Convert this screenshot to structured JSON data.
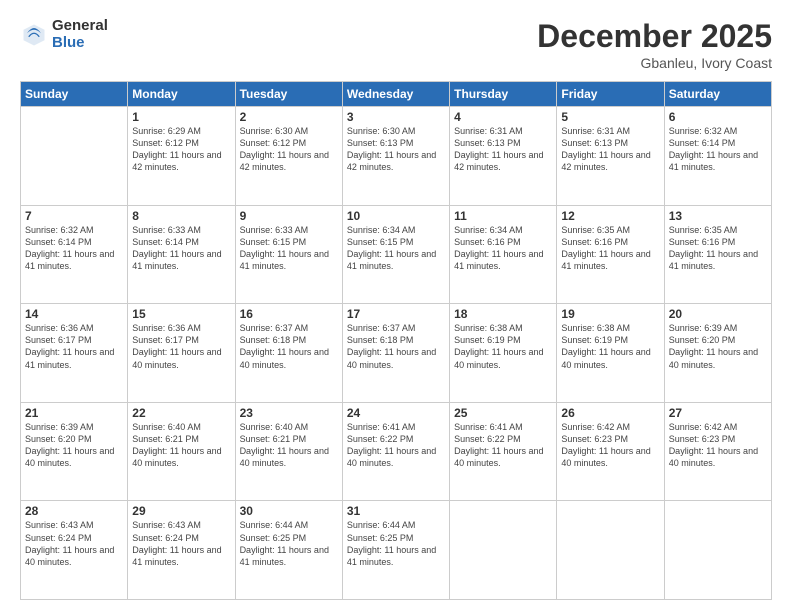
{
  "logo": {
    "general": "General",
    "blue": "Blue"
  },
  "title": "December 2025",
  "subtitle": "Gbanleu, Ivory Coast",
  "weekdays": [
    "Sunday",
    "Monday",
    "Tuesday",
    "Wednesday",
    "Thursday",
    "Friday",
    "Saturday"
  ],
  "weeks": [
    [
      {
        "day": "",
        "sunrise": "",
        "sunset": "",
        "daylight": ""
      },
      {
        "day": "1",
        "sunrise": "Sunrise: 6:29 AM",
        "sunset": "Sunset: 6:12 PM",
        "daylight": "Daylight: 11 hours and 42 minutes."
      },
      {
        "day": "2",
        "sunrise": "Sunrise: 6:30 AM",
        "sunset": "Sunset: 6:12 PM",
        "daylight": "Daylight: 11 hours and 42 minutes."
      },
      {
        "day": "3",
        "sunrise": "Sunrise: 6:30 AM",
        "sunset": "Sunset: 6:13 PM",
        "daylight": "Daylight: 11 hours and 42 minutes."
      },
      {
        "day": "4",
        "sunrise": "Sunrise: 6:31 AM",
        "sunset": "Sunset: 6:13 PM",
        "daylight": "Daylight: 11 hours and 42 minutes."
      },
      {
        "day": "5",
        "sunrise": "Sunrise: 6:31 AM",
        "sunset": "Sunset: 6:13 PM",
        "daylight": "Daylight: 11 hours and 42 minutes."
      },
      {
        "day": "6",
        "sunrise": "Sunrise: 6:32 AM",
        "sunset": "Sunset: 6:14 PM",
        "daylight": "Daylight: 11 hours and 41 minutes."
      }
    ],
    [
      {
        "day": "7",
        "sunrise": "Sunrise: 6:32 AM",
        "sunset": "Sunset: 6:14 PM",
        "daylight": "Daylight: 11 hours and 41 minutes."
      },
      {
        "day": "8",
        "sunrise": "Sunrise: 6:33 AM",
        "sunset": "Sunset: 6:14 PM",
        "daylight": "Daylight: 11 hours and 41 minutes."
      },
      {
        "day": "9",
        "sunrise": "Sunrise: 6:33 AM",
        "sunset": "Sunset: 6:15 PM",
        "daylight": "Daylight: 11 hours and 41 minutes."
      },
      {
        "day": "10",
        "sunrise": "Sunrise: 6:34 AM",
        "sunset": "Sunset: 6:15 PM",
        "daylight": "Daylight: 11 hours and 41 minutes."
      },
      {
        "day": "11",
        "sunrise": "Sunrise: 6:34 AM",
        "sunset": "Sunset: 6:16 PM",
        "daylight": "Daylight: 11 hours and 41 minutes."
      },
      {
        "day": "12",
        "sunrise": "Sunrise: 6:35 AM",
        "sunset": "Sunset: 6:16 PM",
        "daylight": "Daylight: 11 hours and 41 minutes."
      },
      {
        "day": "13",
        "sunrise": "Sunrise: 6:35 AM",
        "sunset": "Sunset: 6:16 PM",
        "daylight": "Daylight: 11 hours and 41 minutes."
      }
    ],
    [
      {
        "day": "14",
        "sunrise": "Sunrise: 6:36 AM",
        "sunset": "Sunset: 6:17 PM",
        "daylight": "Daylight: 11 hours and 41 minutes."
      },
      {
        "day": "15",
        "sunrise": "Sunrise: 6:36 AM",
        "sunset": "Sunset: 6:17 PM",
        "daylight": "Daylight: 11 hours and 40 minutes."
      },
      {
        "day": "16",
        "sunrise": "Sunrise: 6:37 AM",
        "sunset": "Sunset: 6:18 PM",
        "daylight": "Daylight: 11 hours and 40 minutes."
      },
      {
        "day": "17",
        "sunrise": "Sunrise: 6:37 AM",
        "sunset": "Sunset: 6:18 PM",
        "daylight": "Daylight: 11 hours and 40 minutes."
      },
      {
        "day": "18",
        "sunrise": "Sunrise: 6:38 AM",
        "sunset": "Sunset: 6:19 PM",
        "daylight": "Daylight: 11 hours and 40 minutes."
      },
      {
        "day": "19",
        "sunrise": "Sunrise: 6:38 AM",
        "sunset": "Sunset: 6:19 PM",
        "daylight": "Daylight: 11 hours and 40 minutes."
      },
      {
        "day": "20",
        "sunrise": "Sunrise: 6:39 AM",
        "sunset": "Sunset: 6:20 PM",
        "daylight": "Daylight: 11 hours and 40 minutes."
      }
    ],
    [
      {
        "day": "21",
        "sunrise": "Sunrise: 6:39 AM",
        "sunset": "Sunset: 6:20 PM",
        "daylight": "Daylight: 11 hours and 40 minutes."
      },
      {
        "day": "22",
        "sunrise": "Sunrise: 6:40 AM",
        "sunset": "Sunset: 6:21 PM",
        "daylight": "Daylight: 11 hours and 40 minutes."
      },
      {
        "day": "23",
        "sunrise": "Sunrise: 6:40 AM",
        "sunset": "Sunset: 6:21 PM",
        "daylight": "Daylight: 11 hours and 40 minutes."
      },
      {
        "day": "24",
        "sunrise": "Sunrise: 6:41 AM",
        "sunset": "Sunset: 6:22 PM",
        "daylight": "Daylight: 11 hours and 40 minutes."
      },
      {
        "day": "25",
        "sunrise": "Sunrise: 6:41 AM",
        "sunset": "Sunset: 6:22 PM",
        "daylight": "Daylight: 11 hours and 40 minutes."
      },
      {
        "day": "26",
        "sunrise": "Sunrise: 6:42 AM",
        "sunset": "Sunset: 6:23 PM",
        "daylight": "Daylight: 11 hours and 40 minutes."
      },
      {
        "day": "27",
        "sunrise": "Sunrise: 6:42 AM",
        "sunset": "Sunset: 6:23 PM",
        "daylight": "Daylight: 11 hours and 40 minutes."
      }
    ],
    [
      {
        "day": "28",
        "sunrise": "Sunrise: 6:43 AM",
        "sunset": "Sunset: 6:24 PM",
        "daylight": "Daylight: 11 hours and 40 minutes."
      },
      {
        "day": "29",
        "sunrise": "Sunrise: 6:43 AM",
        "sunset": "Sunset: 6:24 PM",
        "daylight": "Daylight: 11 hours and 41 minutes."
      },
      {
        "day": "30",
        "sunrise": "Sunrise: 6:44 AM",
        "sunset": "Sunset: 6:25 PM",
        "daylight": "Daylight: 11 hours and 41 minutes."
      },
      {
        "day": "31",
        "sunrise": "Sunrise: 6:44 AM",
        "sunset": "Sunset: 6:25 PM",
        "daylight": "Daylight: 11 hours and 41 minutes."
      },
      {
        "day": "",
        "sunrise": "",
        "sunset": "",
        "daylight": ""
      },
      {
        "day": "",
        "sunrise": "",
        "sunset": "",
        "daylight": ""
      },
      {
        "day": "",
        "sunrise": "",
        "sunset": "",
        "daylight": ""
      }
    ]
  ]
}
